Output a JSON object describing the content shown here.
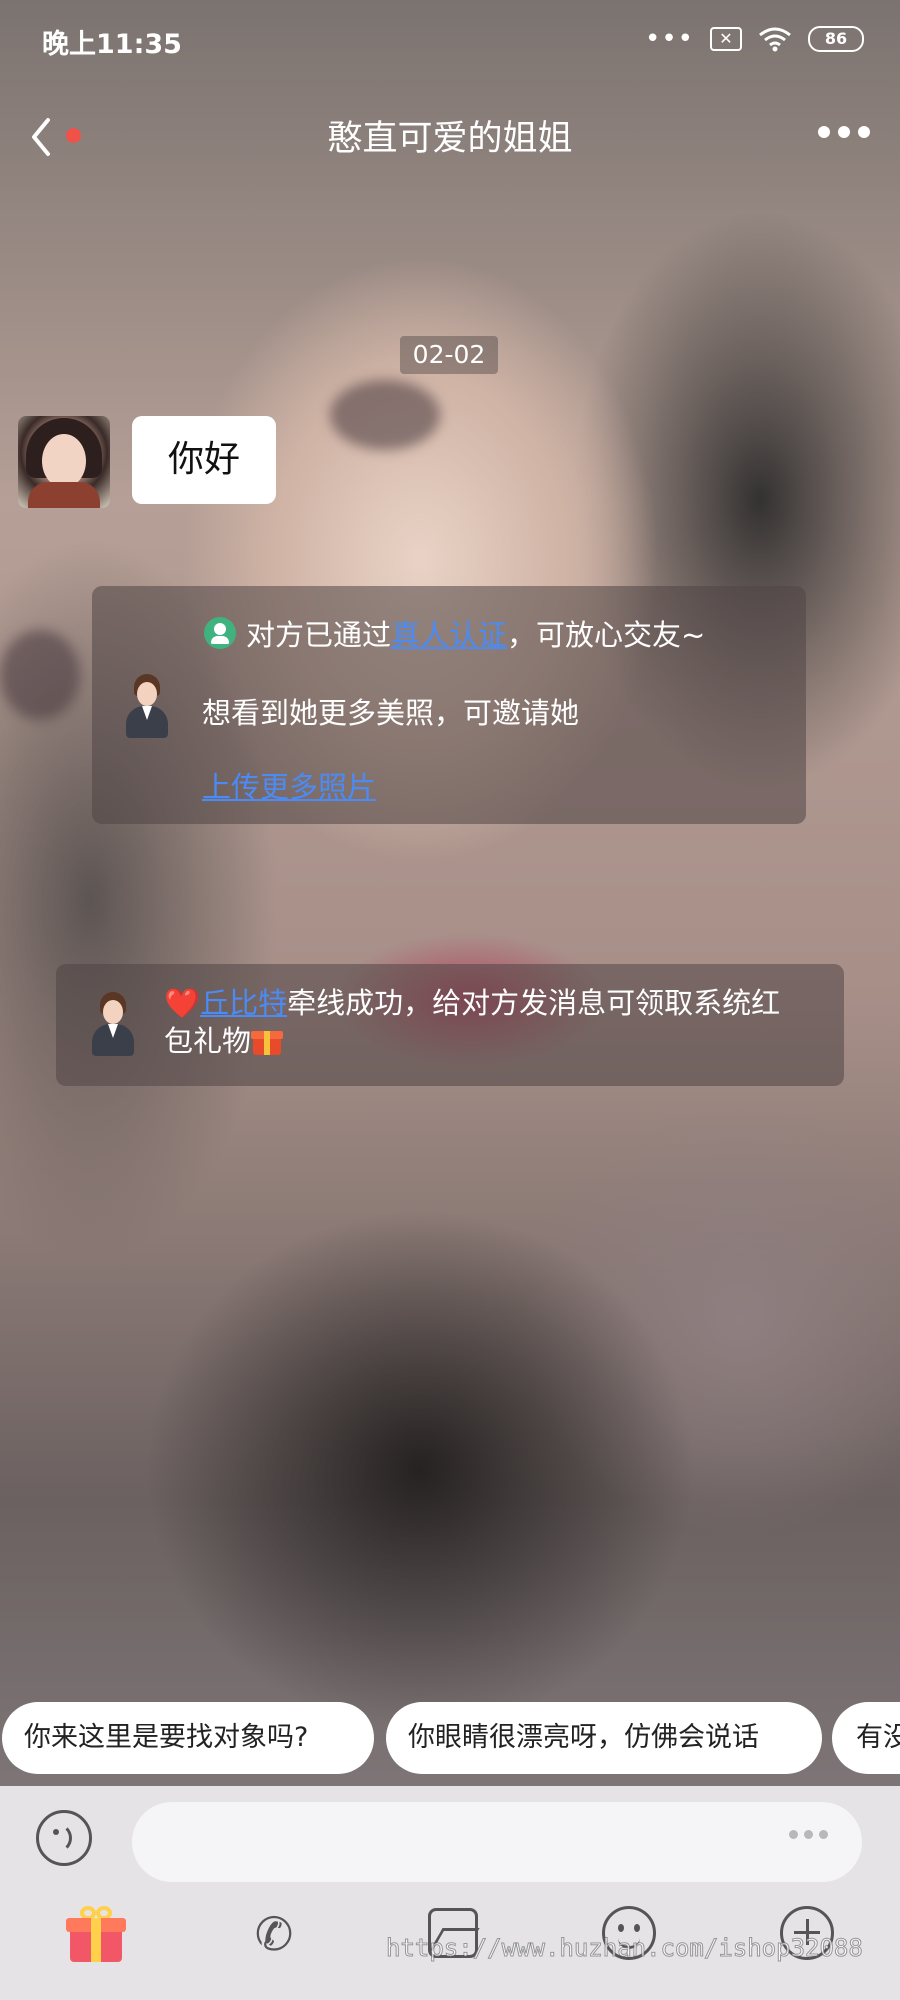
{
  "status_bar": {
    "time": "晚上11:35",
    "dots": "•••",
    "sim_icon": "x-box-icon",
    "wifi_icon": "wifi-icon",
    "battery_level": "86"
  },
  "header": {
    "title": "憨直可爱的姐姐",
    "back_icon": "chevron-left-icon",
    "more_icon": "more-dots-icon"
  },
  "chat": {
    "date": "02-02",
    "messages": [
      {
        "text": "你好"
      }
    ],
    "system_card_1": {
      "line1_prefix": "对方已通过",
      "line1_link": "真人认证",
      "line1_suffix": "，可放心交友~",
      "line2": "想看到她更多美照，可邀请她",
      "line3_link": "上传更多照片"
    },
    "system_card_2": {
      "heart": "❤️",
      "link": "丘比特",
      "text": "牵线成功，给对方发消息可领取系统红包礼物"
    }
  },
  "quick_replies": [
    "你来这里是要找对象吗?",
    "你眼睛很漂亮呀，仿佛会说话",
    "有没"
  ],
  "toolbar": {
    "icons": [
      "voice-icon",
      "gift-icon",
      "video-call-icon",
      "image-icon",
      "emoji-icon",
      "plus-icon"
    ],
    "call_glyph": "✆"
  },
  "watermark": "https://www.huzhan.com/ishop32088",
  "colors": {
    "link": "#4a8bf5",
    "notification_dot": "#f0524a",
    "verified_green": "#3fb27f"
  }
}
